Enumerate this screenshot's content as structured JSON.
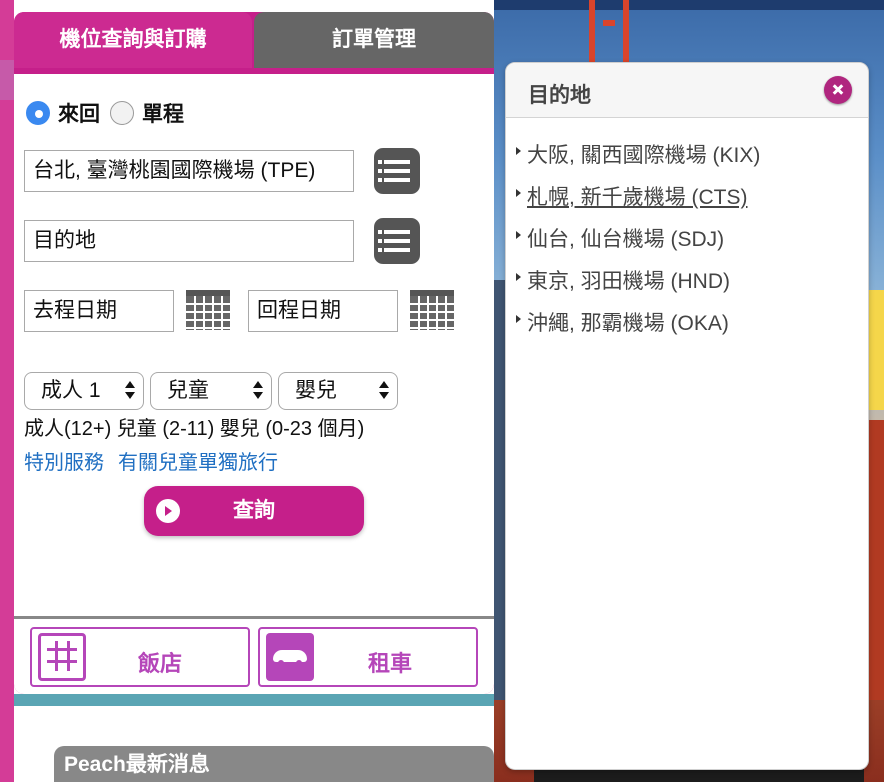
{
  "tabs": {
    "book": "機位查詢與訂購",
    "manage": "訂單管理"
  },
  "trip": {
    "round": "來回",
    "oneway": "單程",
    "selected": "round"
  },
  "origin": "台北, 臺灣桃園國際機場 (TPE)",
  "destination": "目的地",
  "dates": {
    "depart": "去程日期",
    "return": "回程日期"
  },
  "passengers": {
    "adult": "成人 1",
    "child": "兒童",
    "infant": "嬰兒"
  },
  "age_note": "成人(12+) 兒童 (2-11) 嬰兒 (0-23 個月)",
  "links": {
    "special": "特別服務",
    "child_travel": "有關兒童單獨旅行"
  },
  "search_label": "查詢",
  "bottom": {
    "hotel": "飯店",
    "car": "租車"
  },
  "news": "Peach最新消息",
  "popup": {
    "title": "目的地",
    "items": [
      "大阪, 關西國際機場 (KIX)",
      "札幌, 新千歲機場 (CTS)",
      "仙台, 仙台機場 (SDJ)",
      "東京, 羽田機場 (HND)",
      "沖繩, 那霸機場 (OKA)"
    ]
  },
  "colors": {
    "brand": "#c51f8a",
    "tab_inactive": "#666666",
    "link": "#1f6fc2"
  }
}
